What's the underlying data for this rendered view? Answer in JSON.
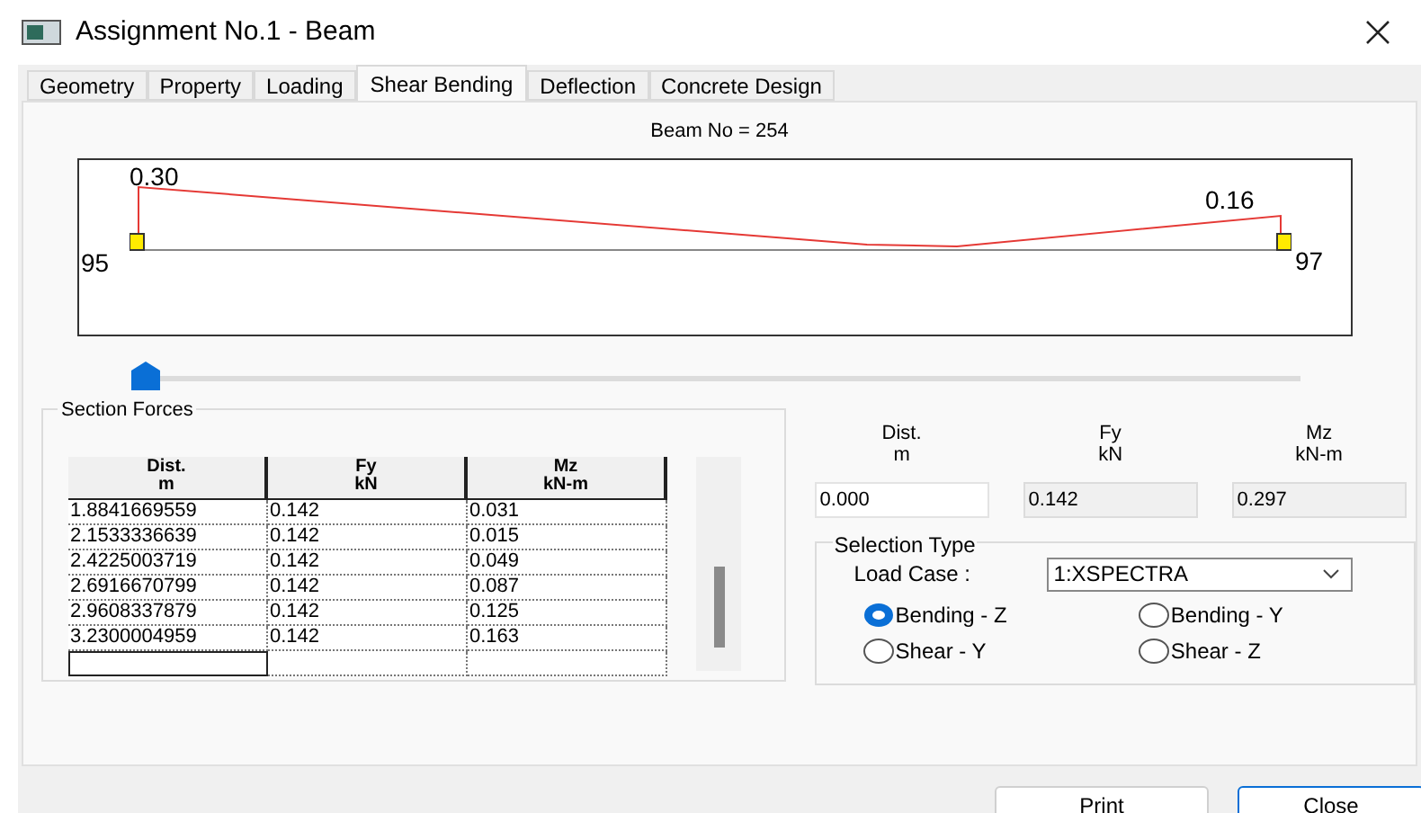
{
  "window": {
    "title": "Assignment No.1 - Beam"
  },
  "tabs": [
    {
      "label": "Geometry",
      "selected": false
    },
    {
      "label": "Property",
      "selected": false
    },
    {
      "label": "Loading",
      "selected": false
    },
    {
      "label": "Shear Bending",
      "selected": true
    },
    {
      "label": "Deflection",
      "selected": false
    },
    {
      "label": "Concrete Design",
      "selected": false
    }
  ],
  "beam_label": "Beam No = 254",
  "diagram": {
    "start_value": "0.30",
    "end_value": "0.16",
    "start_node": "95",
    "end_node": "97"
  },
  "slider": {
    "level": 0
  },
  "section_forces": {
    "title": "Section Forces",
    "columns": [
      {
        "name": "Dist.",
        "unit": "m"
      },
      {
        "name": "Fy",
        "unit": "kN"
      },
      {
        "name": "Mz",
        "unit": "kN-m"
      }
    ],
    "rows": [
      [
        "1.8841669559",
        "0.142",
        "0.031"
      ],
      [
        "2.1533336639",
        "0.142",
        "0.015"
      ],
      [
        "2.4225003719",
        "0.142",
        "0.049"
      ],
      [
        "2.6916670799",
        "0.142",
        "0.087"
      ],
      [
        "2.9608337879",
        "0.142",
        "0.125"
      ],
      [
        "3.2300004959",
        "0.142",
        "0.163"
      ]
    ]
  },
  "readout": [
    {
      "name": "Dist.",
      "unit": "m",
      "value": "0.000",
      "editable": true
    },
    {
      "name": "Fy",
      "unit": "kN",
      "value": "0.142",
      "editable": false
    },
    {
      "name": "Mz",
      "unit": "kN-m",
      "value": "0.297",
      "editable": false
    }
  ],
  "selection_type": {
    "title": "Selection Type",
    "load_case_label": "Load Case :",
    "load_case": "1:XSPECTRA",
    "options": [
      {
        "label": "Bending - Z",
        "selected": true
      },
      {
        "label": "Bending - Y",
        "selected": false
      },
      {
        "label": "Shear - Y",
        "selected": false
      },
      {
        "label": "Shear - Z",
        "selected": false
      }
    ]
  },
  "buttons": [
    "Print",
    "Close"
  ]
}
